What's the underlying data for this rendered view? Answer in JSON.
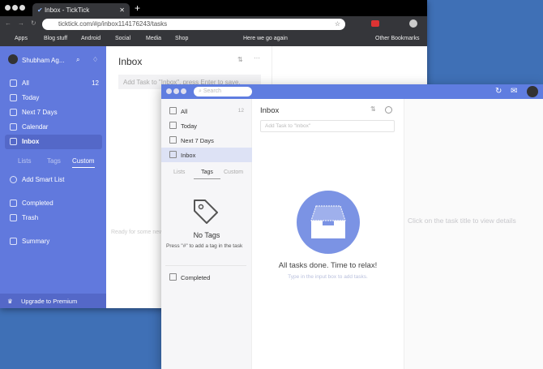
{
  "browser": {
    "tab_title": "Inbox - TickTick",
    "url": "ticktick.com/#p/inbox114176243/tasks",
    "bookmarks": [
      "Apps",
      "Blog stuff",
      "Android",
      "Social",
      "Media",
      "Shop",
      "Here we go again"
    ],
    "other_bookmarks": "Other Bookmarks"
  },
  "web": {
    "user": "Shubham Ag...",
    "nav": [
      {
        "label": "All",
        "count": "12"
      },
      {
        "label": "Today"
      },
      {
        "label": "Next 7 Days"
      },
      {
        "label": "Calendar"
      },
      {
        "label": "Inbox"
      }
    ],
    "tabs": [
      "Lists",
      "Tags",
      "Custom"
    ],
    "add_smart_list": "Add Smart List",
    "completed": "Completed",
    "trash": "Trash",
    "summary": "Summary",
    "upgrade": "Upgrade to Premium",
    "title": "Inbox",
    "add_placeholder": "Add Task to \"Inbox\", press Enter to save.",
    "empty": "Ready for some new"
  },
  "app": {
    "search_placeholder": "Search",
    "nav": [
      {
        "label": "All",
        "count": "12"
      },
      {
        "label": "Today"
      },
      {
        "label": "Next 7 Days"
      },
      {
        "label": "Inbox"
      }
    ],
    "tabs": [
      "Lists",
      "Tags",
      "Custom"
    ],
    "no_tags": "No Tags",
    "no_tags_hint": "Press \"#\" to add a tag in the task",
    "completed": "Completed",
    "title": "Inbox",
    "add_placeholder": "Add Task to \"Inbox\"",
    "empty_title": "All tasks done. Time to relax!",
    "empty_hint": "Type in the input box to add tasks.",
    "details_hint": "Click on the task title to view details"
  },
  "colors": {
    "accent": "#6179dd",
    "desktop": "#3f70b6"
  }
}
